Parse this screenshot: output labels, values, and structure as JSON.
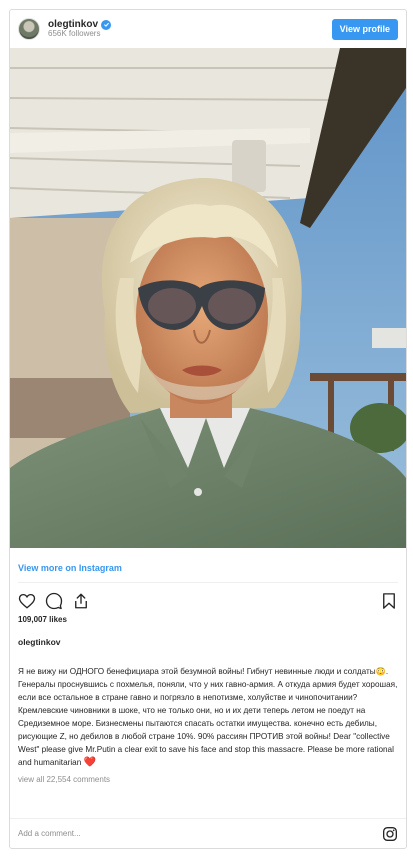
{
  "header": {
    "username": "olegtinkov",
    "followers": "656K followers",
    "view_profile_label": "View profile"
  },
  "post": {
    "view_more_label": "View more on Instagram",
    "likes": "109,007 likes",
    "caption_user": "olegtinkov",
    "caption_p1": "Я не вижу ни ОДНОГО бенефициара этой безумной войны! Гибнут невинные люди и солдаты😳.",
    "caption_p2": "Генералы проснувшись с похмелья, поняли, что у них гавно-армия. А откуда армия будет хорошая, если все остальное в стране гавно и погрязло в непотизме, холуйстве и чинопочитании? Кремлевские чиновники в шоке, что не только они, но и их дети теперь летом не поедут на Средиземное море. Бизнесмены пытаются спасать остатки имущества. конечно есть дебилы, рисующие Z, но дебилов в любой стране 10%. 90% рассиян ПРОТИВ этой войны! Dear \"collective West\" please give Mr.Putin a clear exit to save his face and stop this massacre. Please be more rational and humanitarian",
    "heart": "❤️",
    "comments_label": "view all 22,554 comments"
  },
  "comment_bar": {
    "placeholder": "Add a comment..."
  },
  "icons": {
    "like": "heart-icon",
    "comment": "comment-icon",
    "share": "share-icon",
    "save": "bookmark-icon",
    "brand": "instagram-icon"
  },
  "colors": {
    "accent": "#3897f0",
    "text": "#262626",
    "muted": "#8e8e8e",
    "border": "#dbdbdb"
  }
}
